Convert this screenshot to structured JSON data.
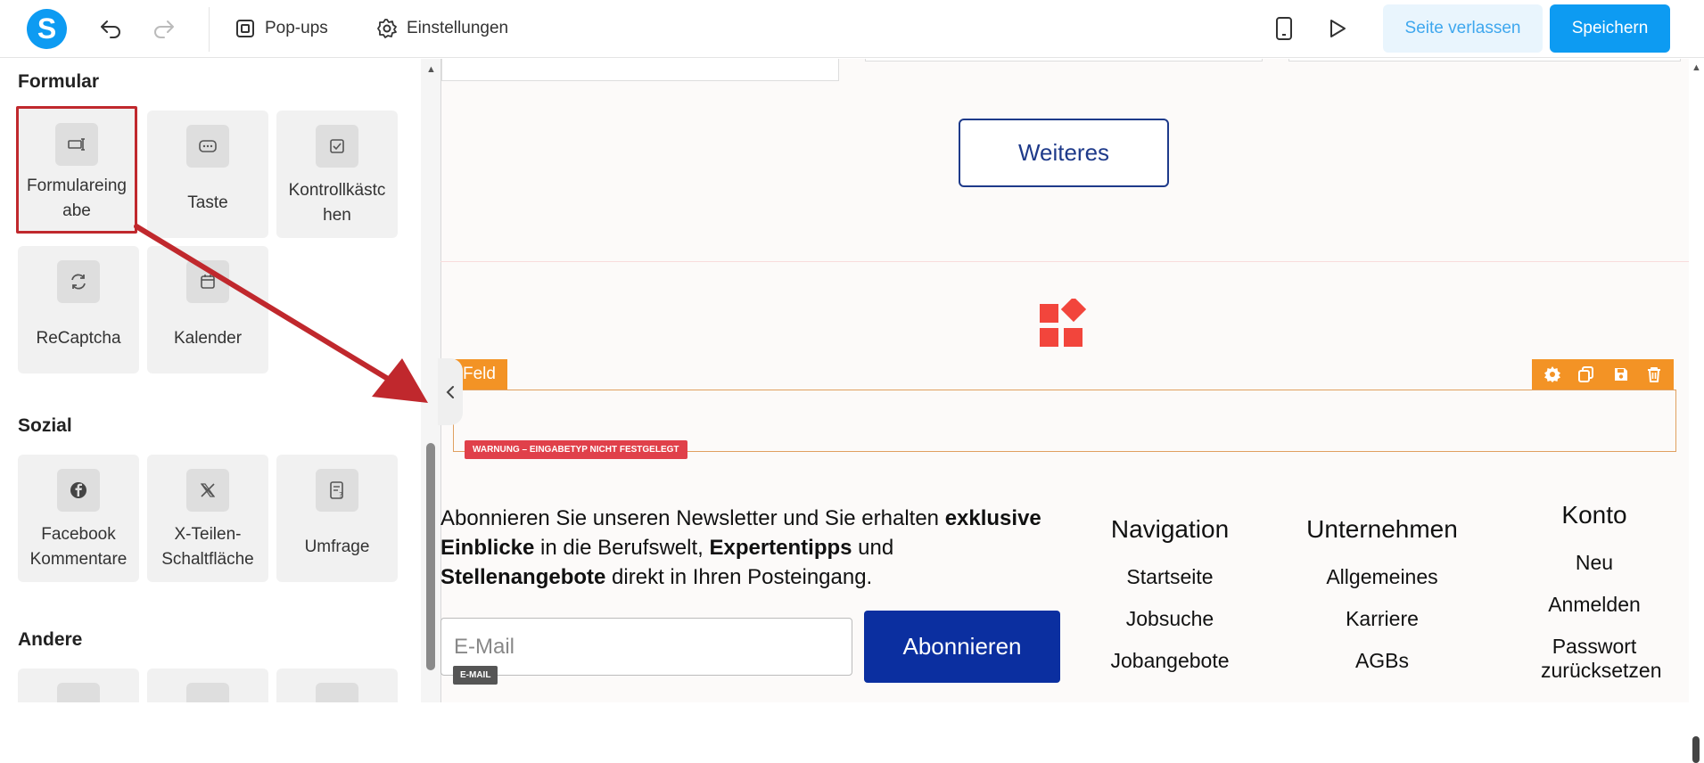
{
  "topbar": {
    "logo_letter": "S",
    "popups_label": "Pop-ups",
    "settings_label": "Einstellungen",
    "leave_label": "Seite verlassen",
    "save_label": "Speichern"
  },
  "sidebar": {
    "sections": [
      {
        "title": "Formular",
        "items": [
          "Formulareingabe",
          "Taste",
          "Kontrollkästchen",
          "ReCaptcha",
          "Kalender"
        ]
      },
      {
        "title": "Sozial",
        "items": [
          "Facebook Kommentare",
          "X-Teilen-Schaltfläche",
          "Umfrage"
        ]
      },
      {
        "title": "Andere",
        "items": []
      }
    ],
    "labels": {
      "formulareingabe": "Formulareing abe",
      "taste": "Taste",
      "kontrollkaestchen": "Kontrollkästc hen",
      "recaptcha": "ReCaptcha",
      "kalender": "Kalender",
      "facebook": "Facebook Kommentare",
      "xshare": "X-Teilen-Schaltfläche",
      "umfrage": "Umfrage"
    },
    "selected_item": "Formulareingabe"
  },
  "canvas": {
    "weiteres_label": "Weiteres",
    "feld_label": "Feld",
    "warning_text": "WARNUNG – EINGABETYP NICHT FESTGELEGT",
    "newsletter": {
      "t1": "Abonnieren Sie unseren Newsletter und Sie erhalten ",
      "b1": "exklusive Einblicke",
      "t2": " in die Berufswelt, ",
      "b2": "Expertentipps",
      "t3": " und ",
      "b3": "Stellenangebote",
      "t4": " direkt in Ihren Posteingang."
    },
    "email_placeholder": "E-Mail",
    "email_tag": "E-MAIL",
    "subscribe_label": "Abonnieren",
    "footer": {
      "navigation": {
        "title": "Navigation",
        "links": [
          "Startseite",
          "Jobsuche",
          "Jobangebote"
        ]
      },
      "unternehmen": {
        "title": "Unternehmen",
        "links": [
          "Allgemeines",
          "Karriere",
          "AGBs"
        ]
      },
      "konto": {
        "title": "Konto",
        "links": [
          "Neu",
          "Anmelden",
          "Passwort zurücksetzen"
        ]
      }
    }
  },
  "colors": {
    "brand": "#0d9bf2",
    "accent_orange": "#f39325",
    "warning_red": "#e0404a",
    "selection_red": "#c0282d",
    "subscribe_blue": "#0b2fa0"
  }
}
